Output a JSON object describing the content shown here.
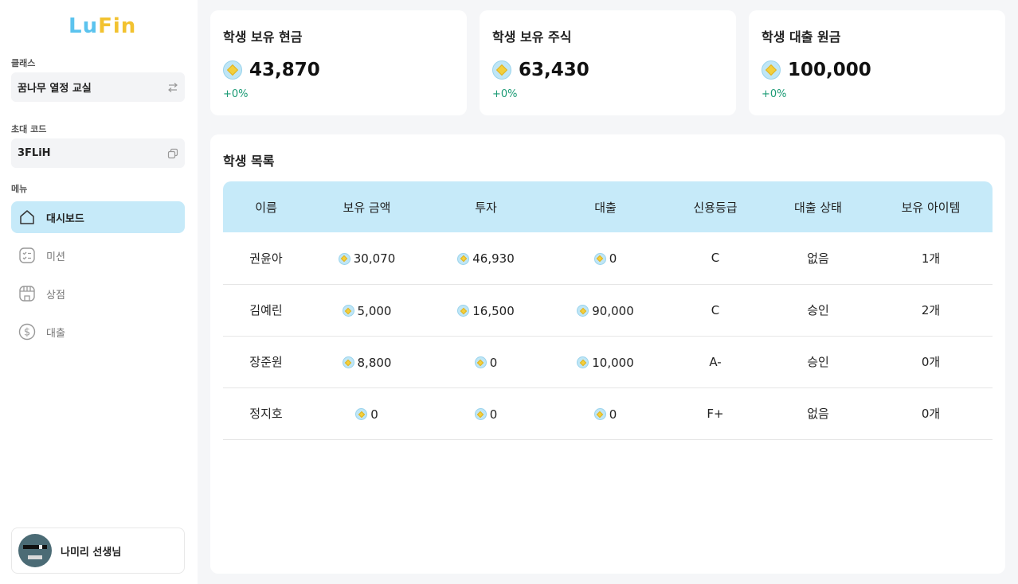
{
  "logo": {
    "part1": "Lu",
    "part2": "Fin"
  },
  "class_section": {
    "label": "클래스",
    "value": "꿈나무 열정 교실"
  },
  "invite_section": {
    "label": "초대 코드",
    "value": "3FLiH"
  },
  "menu": {
    "label": "메뉴",
    "items": [
      {
        "label": "대시보드",
        "icon": "home-icon",
        "active": true
      },
      {
        "label": "미션",
        "icon": "checklist-icon",
        "active": false
      },
      {
        "label": "상점",
        "icon": "store-icon",
        "active": false
      },
      {
        "label": "대출",
        "icon": "dollar-icon",
        "active": false
      }
    ]
  },
  "profile": {
    "name": "나미리 선생님"
  },
  "stats": [
    {
      "title": "학생 보유 현금",
      "value": "43,870",
      "delta": "+0%"
    },
    {
      "title": "학생 보유 주식",
      "value": "63,430",
      "delta": "+0%"
    },
    {
      "title": "학생 대출 원금",
      "value": "100,000",
      "delta": "+0%"
    }
  ],
  "student_list": {
    "title": "학생 목록",
    "headers": [
      "이름",
      "보유 금액",
      "투자",
      "대출",
      "신용등급",
      "대출 상태",
      "보유 아이템"
    ],
    "rows": [
      {
        "name": "권윤아",
        "balance": "30,070",
        "invest": "46,930",
        "loan": "0",
        "credit": "C",
        "loan_status": "없음",
        "items": "1개"
      },
      {
        "name": "김예린",
        "balance": "5,000",
        "invest": "16,500",
        "loan": "90,000",
        "credit": "C",
        "loan_status": "승인",
        "items": "2개"
      },
      {
        "name": "장준원",
        "balance": "8,800",
        "invest": "0",
        "loan": "10,000",
        "credit": "A-",
        "loan_status": "승인",
        "items": "0개"
      },
      {
        "name": "정지호",
        "balance": "0",
        "invest": "0",
        "loan": "0",
        "credit": "F+",
        "loan_status": "없음",
        "items": "0개"
      }
    ]
  },
  "colors": {
    "accent": "#c6eaf9",
    "brand_blue": "#5bc3ee",
    "brand_yellow": "#f2c230",
    "delta_green": "#1a9a74"
  }
}
